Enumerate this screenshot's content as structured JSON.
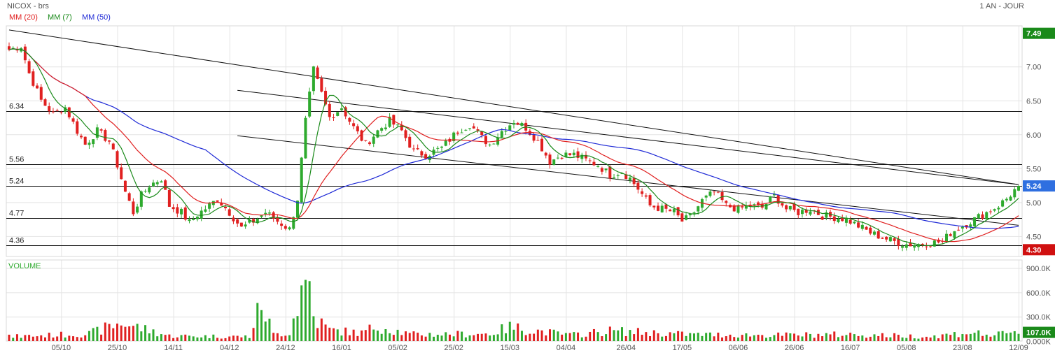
{
  "header": {
    "title": "NICOX - brs",
    "period": "1 AN - JOUR",
    "ma20_label": "MM (20)",
    "ma7_label": "MM (7)",
    "ma50_label": "MM (50)",
    "volume_label": "VOLUME"
  },
  "colors": {
    "up": "#2eaa2e",
    "down": "#e02020",
    "ma20": "#e02020",
    "ma7": "#1a8a1a",
    "ma50": "#1f2ad6",
    "grid": "#e4e4e4",
    "current_price_badge": "#2f6fe0",
    "high_badge": "#1a8a1a",
    "low_badge": "#d01010",
    "volume_badge": "#1a8a1a"
  },
  "chart_data": {
    "type": "candlestick",
    "price_ylim": [
      4.2,
      7.6
    ],
    "price_ticks": [
      "7.00",
      "6.50",
      "6.00",
      "5.50",
      "5.00",
      "4.50"
    ],
    "volume_ylim": [
      0,
      1000000
    ],
    "volume_ticks": [
      "900.0K",
      "600.0K",
      "300.0K",
      "0.000K"
    ],
    "x_ticks": [
      "05/10",
      "25/10",
      "14/11",
      "04/12",
      "24/12",
      "16/01",
      "05/02",
      "25/02",
      "15/03",
      "04/04",
      "26/04",
      "17/05",
      "06/06",
      "26/06",
      "16/07",
      "05/08",
      "23/08",
      "12/09"
    ],
    "horizontal_levels": [
      {
        "label": "6.34",
        "value": 6.34
      },
      {
        "label": "5.56",
        "value": 5.56
      },
      {
        "label": "5.24",
        "value": 5.24
      },
      {
        "label": "4.77",
        "value": 4.77
      },
      {
        "label": "4.36",
        "value": 4.36
      }
    ],
    "badges": {
      "high": "7.49",
      "current": "5.24",
      "low": "4.30",
      "volume": "107.0K"
    },
    "trendlines": [
      {
        "x": [
          0,
          252
        ],
        "y": [
          7.54,
          5.26
        ]
      },
      {
        "x": [
          57,
          252
        ],
        "y": [
          6.65,
          5.26
        ]
      },
      {
        "x": [
          57,
          252
        ],
        "y": [
          5.98,
          4.66
        ]
      }
    ],
    "close_anchors": [
      [
        0,
        7.25
      ],
      [
        3,
        7.3
      ],
      [
        5,
        6.9
      ],
      [
        8,
        6.5
      ],
      [
        11,
        6.3
      ],
      [
        14,
        6.4
      ],
      [
        17,
        6.05
      ],
      [
        19,
        5.85
      ],
      [
        22,
        6.05
      ],
      [
        25,
        5.9
      ],
      [
        27,
        5.55
      ],
      [
        29,
        5.15
      ],
      [
        31,
        4.85
      ],
      [
        33,
        5.1
      ],
      [
        35,
        5.25
      ],
      [
        38,
        5.35
      ],
      [
        40,
        4.95
      ],
      [
        43,
        4.85
      ],
      [
        45,
        4.7
      ],
      [
        47,
        4.82
      ],
      [
        50,
        4.95
      ],
      [
        52,
        5.05
      ],
      [
        55,
        4.85
      ],
      [
        58,
        4.62
      ],
      [
        61,
        4.72
      ],
      [
        64,
        4.85
      ],
      [
        67,
        4.72
      ],
      [
        70,
        4.6
      ],
      [
        72,
        5.05
      ],
      [
        74,
        6.2
      ],
      [
        76,
        6.95
      ],
      [
        78,
        6.6
      ],
      [
        80,
        6.25
      ],
      [
        83,
        6.4
      ],
      [
        86,
        6.1
      ],
      [
        89,
        5.85
      ],
      [
        92,
        6.05
      ],
      [
        95,
        6.2
      ],
      [
        98,
        6.05
      ],
      [
        101,
        5.75
      ],
      [
        104,
        5.7
      ],
      [
        108,
        5.8
      ],
      [
        112,
        6.05
      ],
      [
        115,
        6.15
      ],
      [
        118,
        5.95
      ],
      [
        120,
        5.85
      ],
      [
        123,
        6.05
      ],
      [
        126,
        6.2
      ],
      [
        129,
        6.1
      ],
      [
        132,
        5.9
      ],
      [
        135,
        5.6
      ],
      [
        138,
        5.7
      ],
      [
        141,
        5.7
      ],
      [
        144,
        5.62
      ],
      [
        147,
        5.55
      ],
      [
        150,
        5.4
      ],
      [
        153,
        5.45
      ],
      [
        155,
        5.35
      ],
      [
        157,
        5.2
      ],
      [
        160,
        4.95
      ],
      [
        163,
        4.9
      ],
      [
        166,
        4.85
      ],
      [
        168,
        4.72
      ],
      [
        170,
        4.78
      ],
      [
        173,
        5.02
      ],
      [
        176,
        5.15
      ],
      [
        179,
        4.95
      ],
      [
        182,
        4.9
      ],
      [
        185,
        4.95
      ],
      [
        188,
        4.92
      ],
      [
        191,
        5.1
      ],
      [
        194,
        4.9
      ],
      [
        197,
        4.85
      ],
      [
        200,
        4.9
      ],
      [
        203,
        4.8
      ],
      [
        206,
        4.78
      ],
      [
        209,
        4.75
      ],
      [
        212,
        4.65
      ],
      [
        215,
        4.55
      ],
      [
        218,
        4.48
      ],
      [
        221,
        4.42
      ],
      [
        224,
        4.38
      ],
      [
        227,
        4.38
      ],
      [
        230,
        4.4
      ],
      [
        233,
        4.42
      ],
      [
        235,
        4.55
      ],
      [
        238,
        4.65
      ],
      [
        241,
        4.75
      ],
      [
        244,
        4.85
      ],
      [
        247,
        4.95
      ],
      [
        249,
        5.05
      ],
      [
        252,
        5.24
      ]
    ],
    "volume_anchors": [
      [
        0,
        60000
      ],
      [
        20,
        100000
      ],
      [
        28,
        250000
      ],
      [
        40,
        70000
      ],
      [
        60,
        60000
      ],
      [
        63,
        520000
      ],
      [
        66,
        90000
      ],
      [
        70,
        120000
      ],
      [
        73,
        700000
      ],
      [
        74,
        760000
      ],
      [
        75,
        820000
      ],
      [
        76,
        330000
      ],
      [
        80,
        150000
      ],
      [
        88,
        110000
      ],
      [
        92,
        210000
      ],
      [
        100,
        90000
      ],
      [
        120,
        100000
      ],
      [
        125,
        190000
      ],
      [
        140,
        80000
      ],
      [
        150,
        140000
      ],
      [
        170,
        90000
      ],
      [
        190,
        80000
      ],
      [
        210,
        90000
      ],
      [
        230,
        60000
      ],
      [
        240,
        120000
      ],
      [
        245,
        80000
      ],
      [
        252,
        107000
      ]
    ]
  }
}
